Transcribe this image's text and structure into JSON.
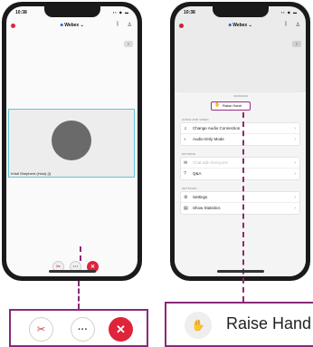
{
  "phone_left": {
    "status": {
      "time": "10:38",
      "icons": "▪▪ ◆ ▬"
    },
    "top_bar": {
      "app_name": "Webex",
      "app_caret": "⌄",
      "bluetooth_glyph": "ᛒ",
      "person_glyph": "♙"
    },
    "side_button_glyph": "≡",
    "participant": {
      "name": "Kristi Shepherd (Host) (I)"
    },
    "controls": {
      "mute_glyph": "✂",
      "more_glyph": "···",
      "end_glyph": "✕"
    }
  },
  "phone_right": {
    "status": {
      "time": "10:38",
      "icons": "▪▪ ◆ ▬"
    },
    "top_bar": {
      "app_name": "Webex",
      "app_caret": "⌄",
      "bluetooth_glyph": "ᛒ",
      "person_glyph": "♙"
    },
    "side_button_glyph": "≡",
    "sheet": {
      "raise_hand_label": "Raise Hand",
      "raise_hand_glyph": "✋",
      "sections": [
        {
          "label": "Audio and Video",
          "items": [
            {
              "label": "Change Audio Connection",
              "icon": "♫",
              "disabled": false
            },
            {
              "label": "Audio-Only Mode",
              "icon": "♪",
              "disabled": false
            }
          ]
        },
        {
          "label": "Options",
          "items": [
            {
              "label": "Chat with Everyone",
              "icon": "✉",
              "disabled": true
            },
            {
              "label": "Q&A",
              "icon": "?",
              "disabled": false
            }
          ]
        },
        {
          "label": "Settings",
          "items": [
            {
              "label": "Settings",
              "icon": "⚙",
              "disabled": false
            },
            {
              "label": "Show Statistics",
              "icon": "▤",
              "disabled": false
            }
          ]
        }
      ],
      "chevron_glyph": "›"
    }
  },
  "zoom_left": {
    "mute_glyph": "✂",
    "more_glyph": "···",
    "end_glyph": "✕"
  },
  "zoom_right": {
    "icon_glyph": "✋",
    "label": "Raise Hand"
  },
  "colors": {
    "accent": "#8a2a78",
    "end_call": "#e0243a",
    "tile_border": "#5bc8d6"
  }
}
